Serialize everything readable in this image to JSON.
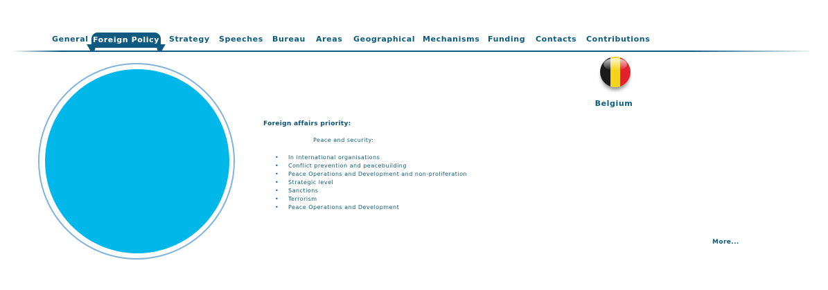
{
  "nav": {
    "tabs": [
      {
        "label": "General"
      },
      {
        "label": "Foreign Policy",
        "active": true
      },
      {
        "label": "Strategy"
      },
      {
        "label": "Speeches"
      },
      {
        "label": "Bureau"
      },
      {
        "label": "Areas"
      },
      {
        "label": "Geographical"
      },
      {
        "label": "Mechanisms"
      },
      {
        "label": "Funding"
      },
      {
        "label": "Contacts"
      },
      {
        "label": "Contributions"
      }
    ],
    "accent_color": "#0e5a80"
  },
  "country": {
    "name": "Belgium",
    "flag_colors": [
      "#1a1a1a",
      "#f6d31b",
      "#e3202b"
    ]
  },
  "circle": {
    "fill_color": "#00b7ea",
    "ring_color": "#7fb3d8"
  },
  "content": {
    "title": "Foreign affairs priority:",
    "subheading": "Peace and security:",
    "bullet": "•",
    "items": [
      "In international organisations",
      "Conflict prevention and peacebuilding",
      "Peace Operations and Development and non-proliferation",
      "Strategic level",
      "Sanctions",
      "Terrorism",
      "Peace Operations and Development"
    ],
    "more_label": "More..."
  }
}
